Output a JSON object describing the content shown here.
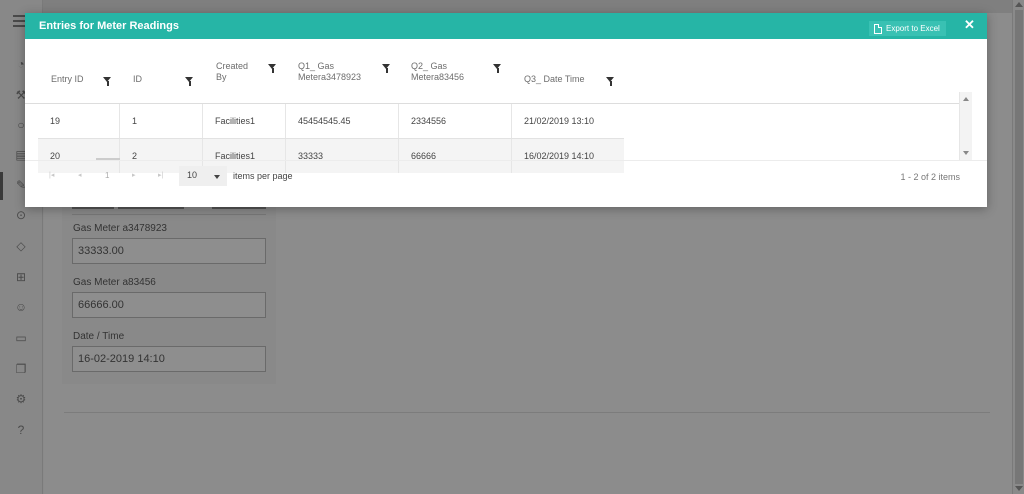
{
  "modal": {
    "title": "Entries for Meter Readings",
    "export_label": "Export to Excel",
    "close_glyph": "✕"
  },
  "grid": {
    "columns": [
      {
        "label_line1": "Entry ID",
        "label_line2": ""
      },
      {
        "label_line1": "ID",
        "label_line2": ""
      },
      {
        "label_line1": "Created",
        "label_line2": "By"
      },
      {
        "label_line1": "Q1_ Gas",
        "label_line2": "Metera3478923"
      },
      {
        "label_line1": "Q2_ Gas",
        "label_line2": "Metera83456"
      },
      {
        "label_line1": "Q3_ Date Time",
        "label_line2": ""
      }
    ],
    "rows": [
      [
        "19",
        "1",
        "Facilities1",
        "45454545.45",
        "2334556",
        "21/02/2019 13:10"
      ],
      [
        "20",
        "2",
        "Facilities1",
        "33333",
        "66666",
        "16/02/2019 14:10"
      ]
    ]
  },
  "pager": {
    "first": "|◂",
    "prev": "◂",
    "current_page": "1",
    "next": "▸",
    "last": "▸|",
    "page_size": "10",
    "per_page_label": "items per page",
    "range_info": "1 - 2 of 2 items"
  },
  "background_form": {
    "field1_label": "Gas Meter a3478923",
    "field1_value": "33333.00",
    "field2_label": "Gas Meter a83456",
    "field2_value": "66666.00",
    "field3_label": "Date / Time",
    "field3_value": "16-02-2019 14:10"
  },
  "sidebar_icons": [
    "dashboard-icon",
    "wrench-icon",
    "search-icon",
    "calendar-icon",
    "edit-icon",
    "location-icon",
    "tag-icon",
    "assets-icon",
    "user-icon",
    "folder-icon",
    "documents-icon",
    "settings-icon",
    "help-icon"
  ],
  "colors": {
    "accent": "#26b5a6",
    "overlay": "#8a8a8a"
  }
}
